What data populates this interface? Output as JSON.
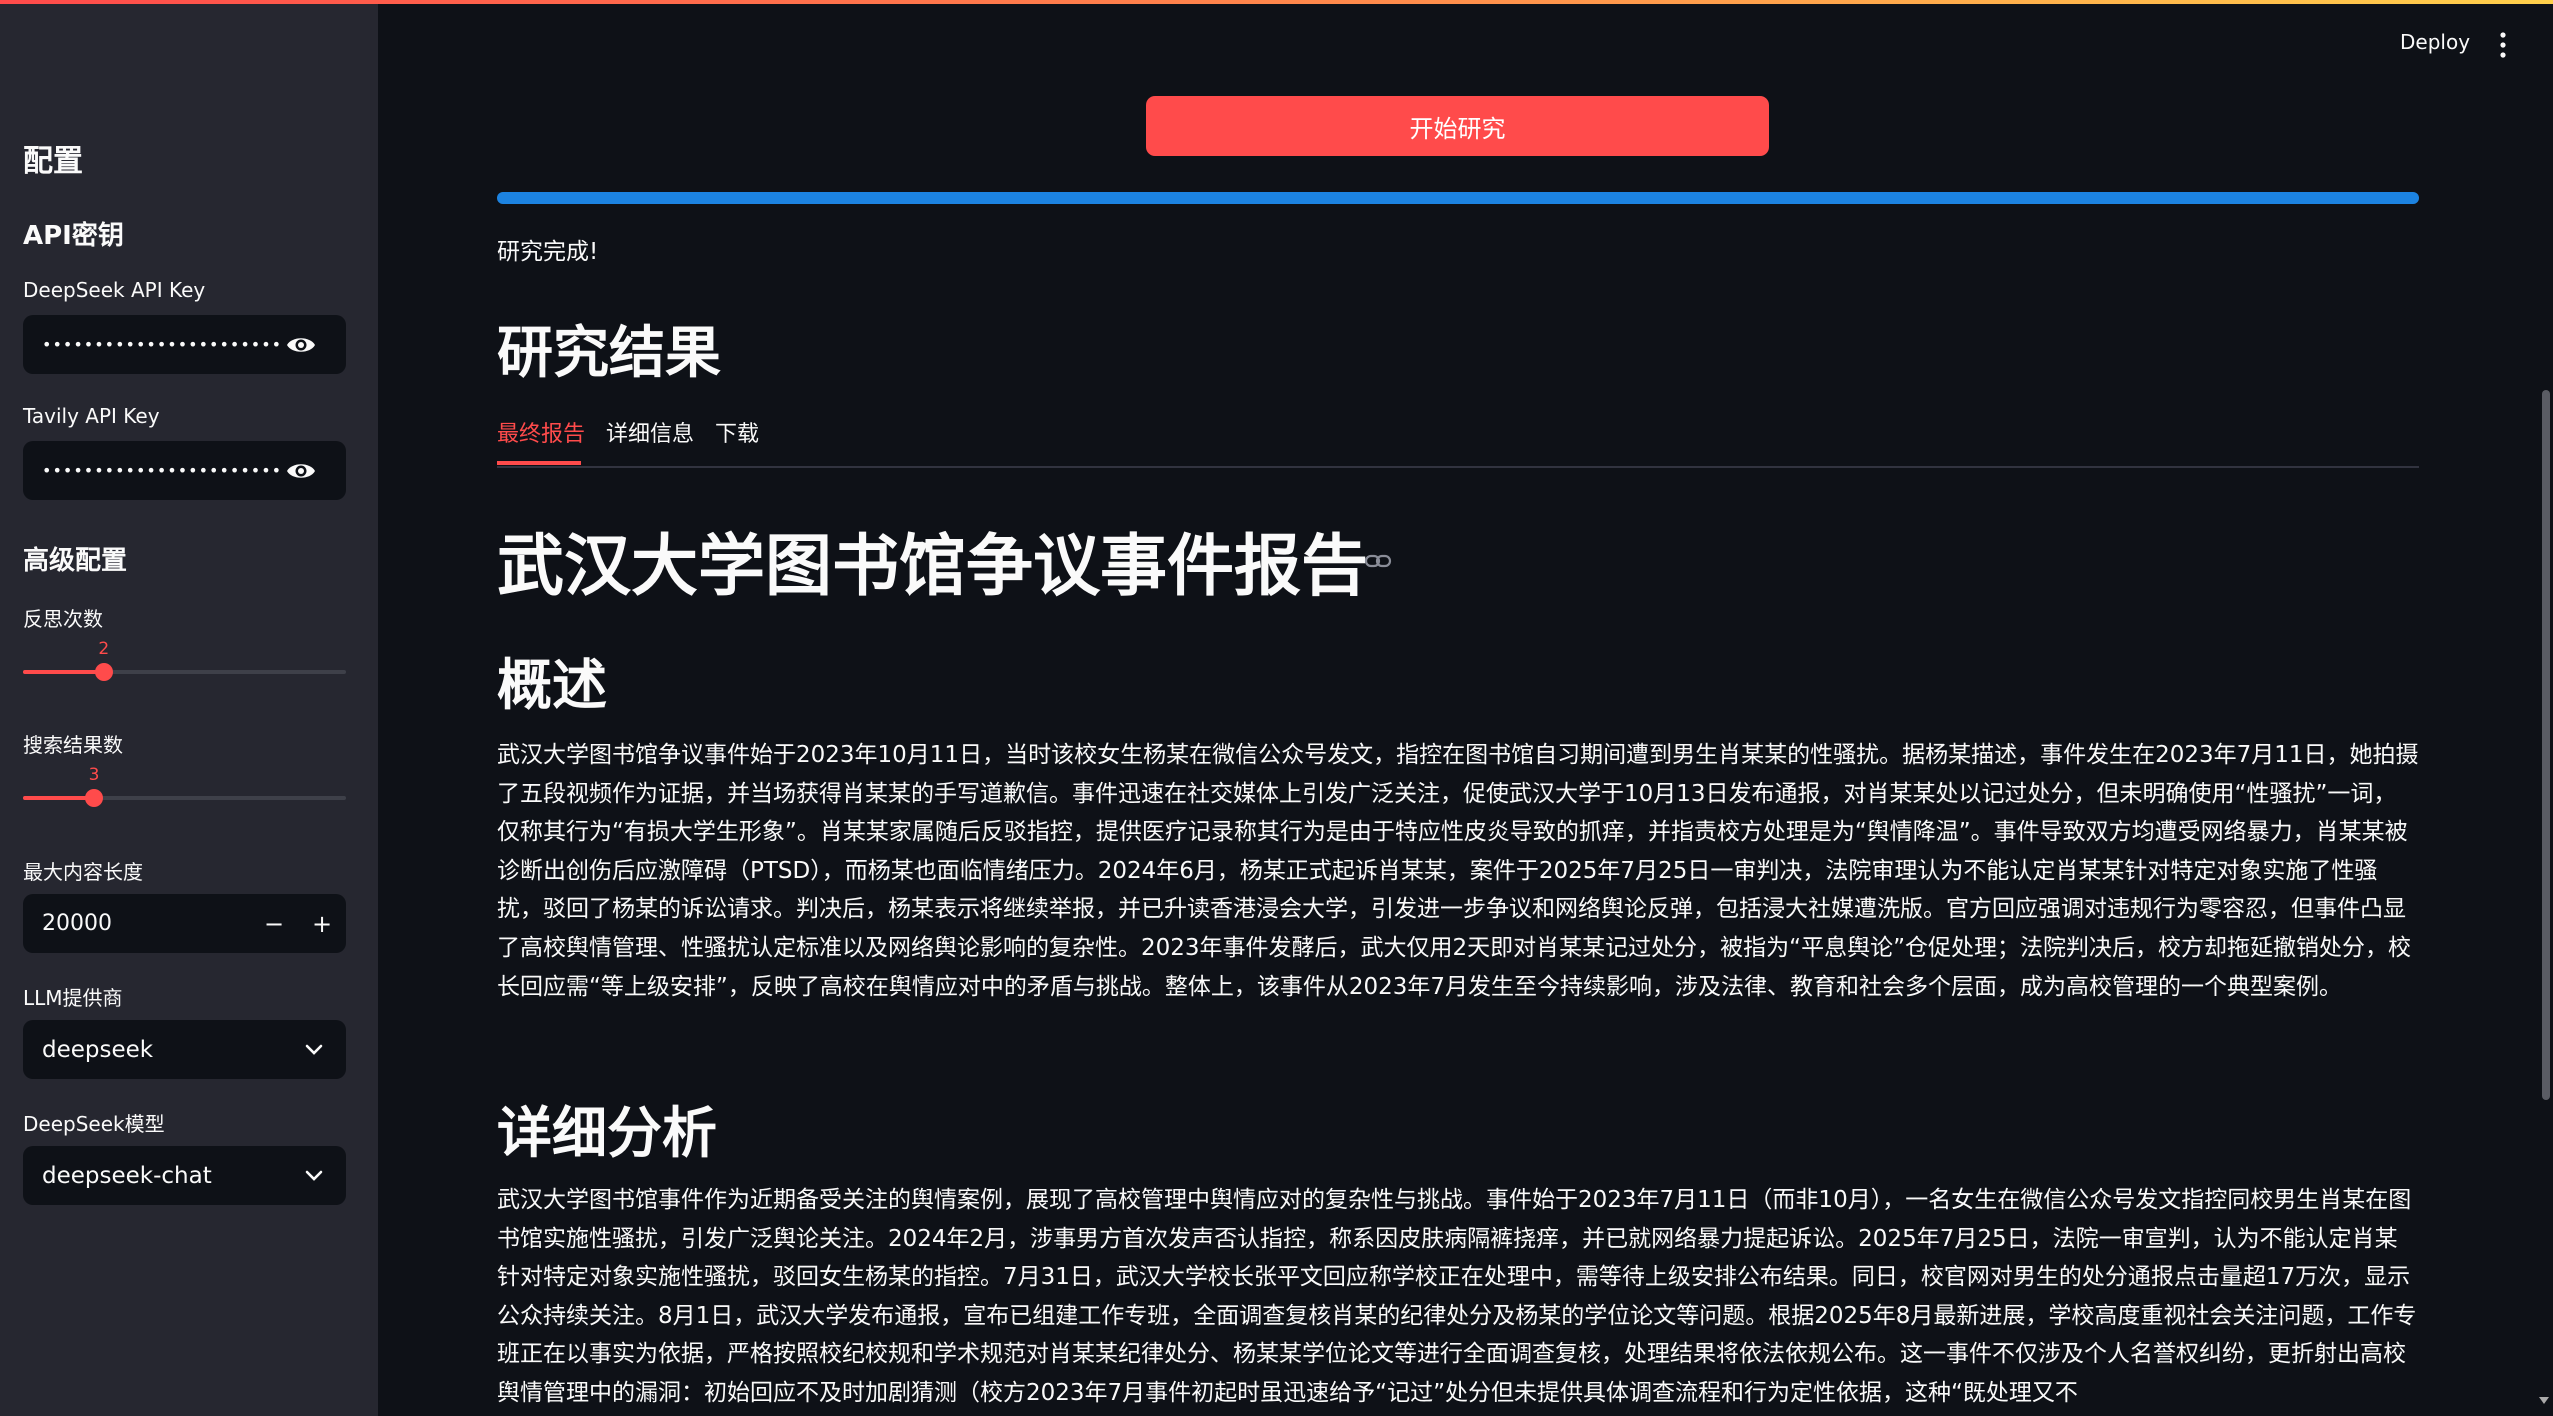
{
  "sidebar": {
    "title": "配置",
    "api_heading": "API密钥",
    "deepseek_key_label": "DeepSeek API Key",
    "deepseek_key_value": "•••••••••••••••••••••••••••••••••••",
    "tavily_key_label": "Tavily API Key",
    "tavily_key_value": "•••••••••••••••••••••••••••••••••••",
    "advanced_heading": "高级配置",
    "reflection_label": "反思次数",
    "reflection_value": "2",
    "reflection_fraction": 0.25,
    "search_label": "搜索结果数",
    "search_value": "3",
    "search_fraction": 0.22,
    "max_len_label": "最大内容长度",
    "max_len_value": "20000",
    "minus": "−",
    "plus": "+",
    "llm_provider_label": "LLM提供商",
    "llm_provider_value": "deepseek",
    "model_label": "DeepSeek模型",
    "model_value": "deepseek-chat"
  },
  "header": {
    "deploy": "Deploy"
  },
  "main": {
    "start_button": "开始研究",
    "progress": 1.0,
    "status": "研究完成!",
    "results_title": "研究结果",
    "tabs": [
      "最终报告",
      "详细信息",
      "下载"
    ],
    "report_title": "武汉大学图书馆争议事件报告",
    "overview_title": "概述",
    "overview_text": "武汉大学图书馆争议事件始于2023年10月11日，当时该校女生杨某在微信公众号发文，指控在图书馆自习期间遭到男生肖某某的性骚扰。据杨某描述，事件发生在2023年7月11日，她拍摄了五段视频作为证据，并当场获得肖某某的手写道歉信。事件迅速在社交媒体上引发广泛关注，促使武汉大学于10月13日发布通报，对肖某某处以记过处分，但未明确使用“性骚扰”一词，仅称其行为“有损大学生形象”。肖某某家属随后反驳指控，提供医疗记录称其行为是由于特应性皮炎导致的抓痒，并指责校方处理是为“舆情降温”。事件导致双方均遭受网络暴力，肖某某被诊断出创伤后应激障碍（PTSD），而杨某也面临情绪压力。2024年6月，杨某正式起诉肖某某，案件于2025年7月25日一审判决，法院审理认为不能认定肖某某针对特定对象实施了性骚扰，驳回了杨某的诉讼请求。判决后，杨某表示将继续举报，并已升读香港浸会大学，引发进一步争议和网络舆论反弹，包括浸大社媒遭洗版。官方回应强调对违规行为零容忍，但事件凸显了高校舆情管理、性骚扰认定标准以及网络舆论影响的复杂性。2023年事件发酵后，武大仅用2天即对肖某某记过处分，被指为“平息舆论”仓促处理；法院判决后，校方却拖延撤销处分，校长回应需“等上级安排”，反映了高校在舆情应对中的矛盾与挑战。整体上，该事件从2023年7月发生至今持续影响，涉及法律、教育和社会多个层面，成为高校管理的一个典型案例。",
    "analysis_title": "详细分析",
    "analysis_text": "武汉大学图书馆事件作为近期备受关注的舆情案例，展现了高校管理中舆情应对的复杂性与挑战。事件始于2023年7月11日（而非10月），一名女生在微信公众号发文指控同校男生肖某在图书馆实施性骚扰，引发广泛舆论关注。2024年2月，涉事男方首次发声否认指控，称系因皮肤病隔裤挠痒，并已就网络暴力提起诉讼。2025年7月25日，法院一审宣判，认为不能认定肖某针对特定对象实施性骚扰，驳回女生杨某的指控。7月31日，武汉大学校长张平文回应称学校正在处理中，需等待上级安排公布结果。同日，校官网对男生的处分通报点击量超17万次，显示公众持续关注。8月1日，武汉大学发布通报，宣布已组建工作专班，全面调查复核肖某的纪律处分及杨某的学位论文等问题。根据2025年8月最新进展，学校高度重视社会关注问题，工作专班正在以事实为依据，严格按照校纪校规和学术规范对肖某某纪律处分、杨某某学位论文等进行全面调查复核，处理结果将依法依规公布。这一事件不仅涉及个人名誉权纠纷，更折射出高校舆情管理中的漏洞：初始回应不及时加剧猜测（校方2023年7月事件初起时虽迅速给予“记过”处分但未提供具体调查流程和行为定性依据，这种“既处理又不"
  },
  "colors": {
    "accent": "#ff4b4b",
    "progress": "#1c83e1",
    "bg": "#0e1117",
    "sidebar": "#262730"
  }
}
